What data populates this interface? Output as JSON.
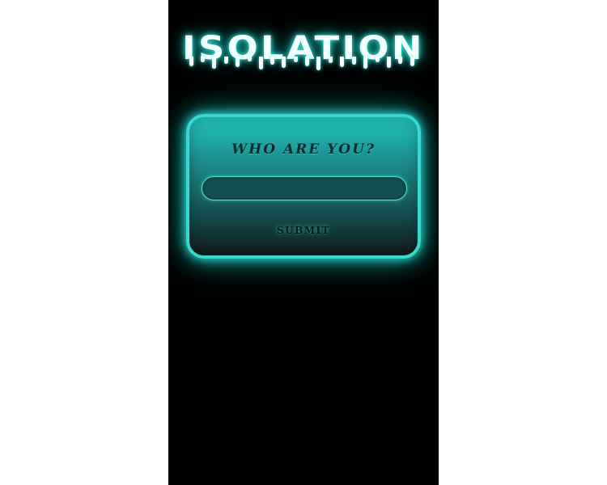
{
  "app": {
    "title": "ISOLATION"
  },
  "form": {
    "question": "WHO ARE YOU?",
    "name_input": {
      "value": "",
      "placeholder": ""
    },
    "submit_label": "SUBMIT"
  },
  "theme": {
    "background": "#000000",
    "accent": "#38d8cf",
    "title_color": "#f4ffff",
    "text_dark": "#0e2a2d"
  }
}
